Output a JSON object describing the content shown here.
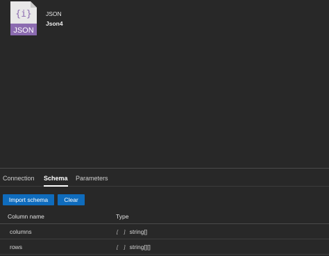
{
  "dataset": {
    "type_label": "JSON",
    "name": "Json4",
    "icon_label": "JSON"
  },
  "tabs": [
    {
      "label": "Connection",
      "active": false
    },
    {
      "label": "Schema",
      "active": true
    },
    {
      "label": "Parameters",
      "active": false
    }
  ],
  "buttons": {
    "import_schema": "Import schema",
    "clear": "Clear"
  },
  "table": {
    "headers": [
      "Column name",
      "Type"
    ],
    "rows": [
      {
        "name": "columns",
        "type_icon": "[ ]",
        "type": "string[]"
      },
      {
        "name": "rows",
        "type_icon": "[ ]",
        "type": "string[][]"
      }
    ]
  },
  "colors": {
    "background": "#282828",
    "accent": "#0f6cbd",
    "icon_band": "#8b6bb0",
    "icon_body": "#e8e8e8"
  }
}
